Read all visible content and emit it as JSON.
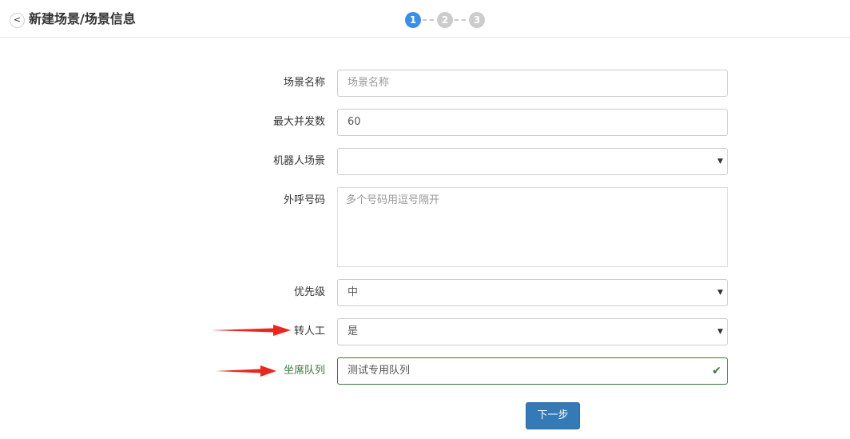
{
  "header": {
    "back_glyph": "<",
    "title": "新建场景/场景信息"
  },
  "steps": [
    {
      "label": "1",
      "active": true
    },
    {
      "label": "2",
      "active": false
    },
    {
      "label": "3",
      "active": false
    }
  ],
  "form": {
    "scene_name": {
      "label": "场景名称",
      "placeholder": "场景名称",
      "value": ""
    },
    "max_concurrency": {
      "label": "最大并发数",
      "value": "60"
    },
    "robot_scene": {
      "label": "机器人场景",
      "value": ""
    },
    "outbound_numbers": {
      "label": "外呼号码",
      "placeholder": "多个号码用逗号隔开"
    },
    "priority": {
      "label": "优先级",
      "value": "中"
    },
    "transfer_to_human": {
      "label": "转人工",
      "value": "是"
    },
    "agent_queue": {
      "label": "坐席队列",
      "value": "测试专用队列"
    }
  },
  "next_button": {
    "label": "下一步"
  },
  "colors": {
    "accent": "#337ab7",
    "step_active": "#3a8ee6",
    "step_inactive": "#cccccc",
    "success": "#3c763d",
    "annotation_arrow": "#e8281e"
  },
  "icons": {
    "back": "chevron-left-icon",
    "select": "caret-down-icon",
    "valid": "checkmark-icon",
    "annotation": "red-arrow-icon"
  }
}
